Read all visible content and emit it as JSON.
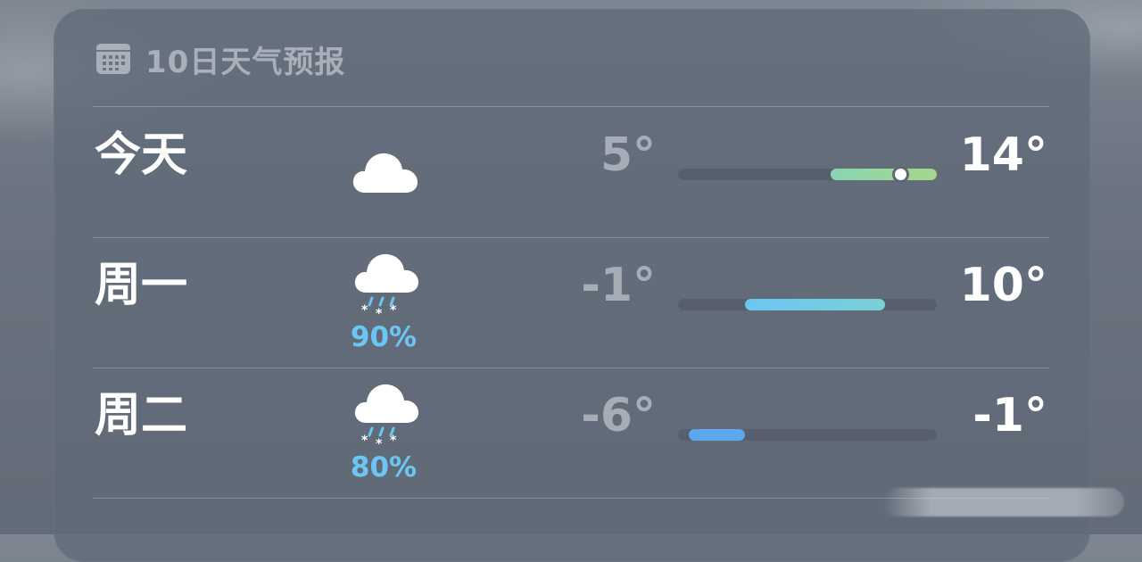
{
  "header": {
    "icon": "calendar-icon",
    "title": "10日天气预报"
  },
  "forecast": [
    {
      "day": "今天",
      "icon": "cloud-icon",
      "precip": "",
      "low": "5°",
      "high": "14°",
      "range_start": 0.59,
      "range_end": 1.0,
      "current_marker": 0.86,
      "colors": [
        "#89d5b2",
        "#a6d68a"
      ]
    },
    {
      "day": "周一",
      "icon": "snow-cloud-icon",
      "precip": "90%",
      "low": "-1°",
      "high": "10°",
      "range_start": 0.26,
      "range_end": 0.8,
      "colors": [
        "#6cc6f3",
        "#79d0d6"
      ]
    },
    {
      "day": "周二",
      "icon": "snow-cloud-icon",
      "precip": "80%",
      "low": "-6°",
      "high": "-1°",
      "range_start": 0.04,
      "range_end": 0.26,
      "colors": [
        "#5ba8ee",
        "#5ba8ee"
      ]
    }
  ],
  "colors": {
    "precip_blue": "#6cc6f3",
    "low_temp_gray": "#a6adb6",
    "track": "#565f6b"
  }
}
